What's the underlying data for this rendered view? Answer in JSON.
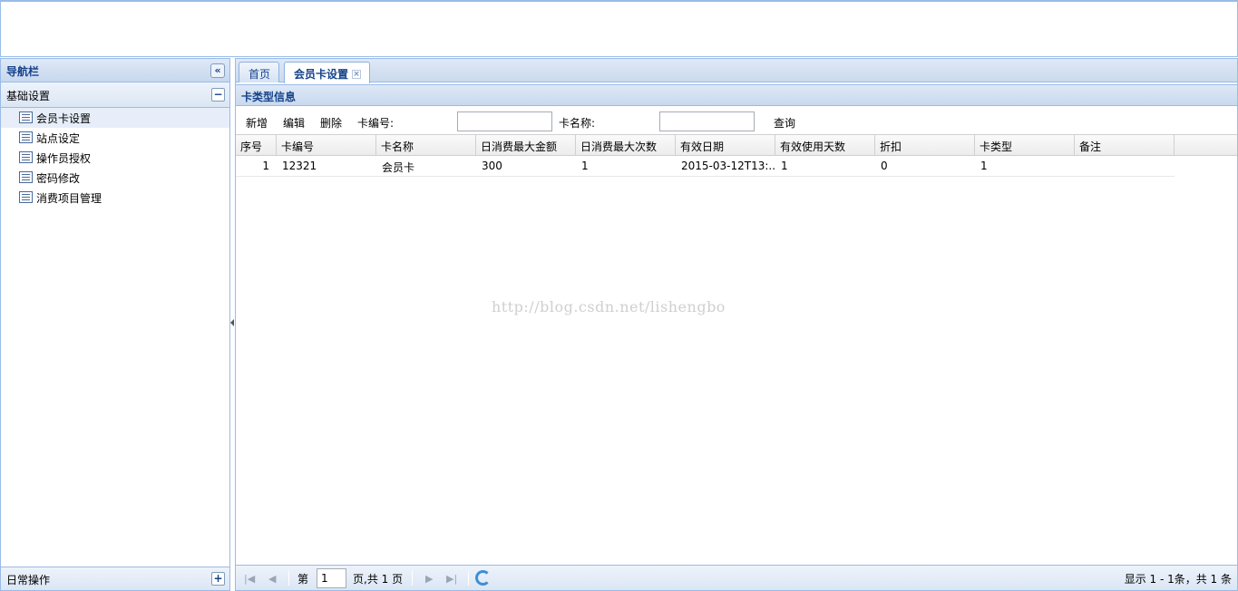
{
  "nav": {
    "title": "导航栏",
    "collapse_icon": "«",
    "sections": [
      {
        "title": "基础设置",
        "tool": "−"
      },
      {
        "title": "日常操作",
        "tool": "+"
      }
    ],
    "items": [
      {
        "label": "会员卡设置"
      },
      {
        "label": "站点设定"
      },
      {
        "label": "操作员授权"
      },
      {
        "label": "密码修改"
      },
      {
        "label": "消费项目管理"
      }
    ]
  },
  "tabs": [
    {
      "label": "首页"
    },
    {
      "label": "会员卡设置",
      "close": "×"
    }
  ],
  "panel": {
    "title": "卡类型信息"
  },
  "toolbar": {
    "add": "新增",
    "edit": "编辑",
    "delete": "删除",
    "card_no_label": "卡编号:",
    "card_no_value": "",
    "card_name_label": "卡名称:",
    "card_name_value": "",
    "query": "查询"
  },
  "grid": {
    "columns": [
      "序号",
      "卡编号",
      "卡名称",
      "日消费最大金额",
      "日消费最大次数",
      "有效日期",
      "有效使用天数",
      "折扣",
      "卡类型",
      "备注"
    ],
    "rows": [
      [
        "1",
        "12321",
        "会员卡",
        "300",
        "1",
        "2015-03-12T13:...",
        "1",
        "0",
        "1",
        ""
      ]
    ]
  },
  "watermark": "http://blog.csdn.net/lishengbo",
  "pager": {
    "page_prefix": "第",
    "page_value": "1",
    "page_suffix": "页,共 1 页",
    "info": "显示 1 - 1条，共 1 条"
  }
}
